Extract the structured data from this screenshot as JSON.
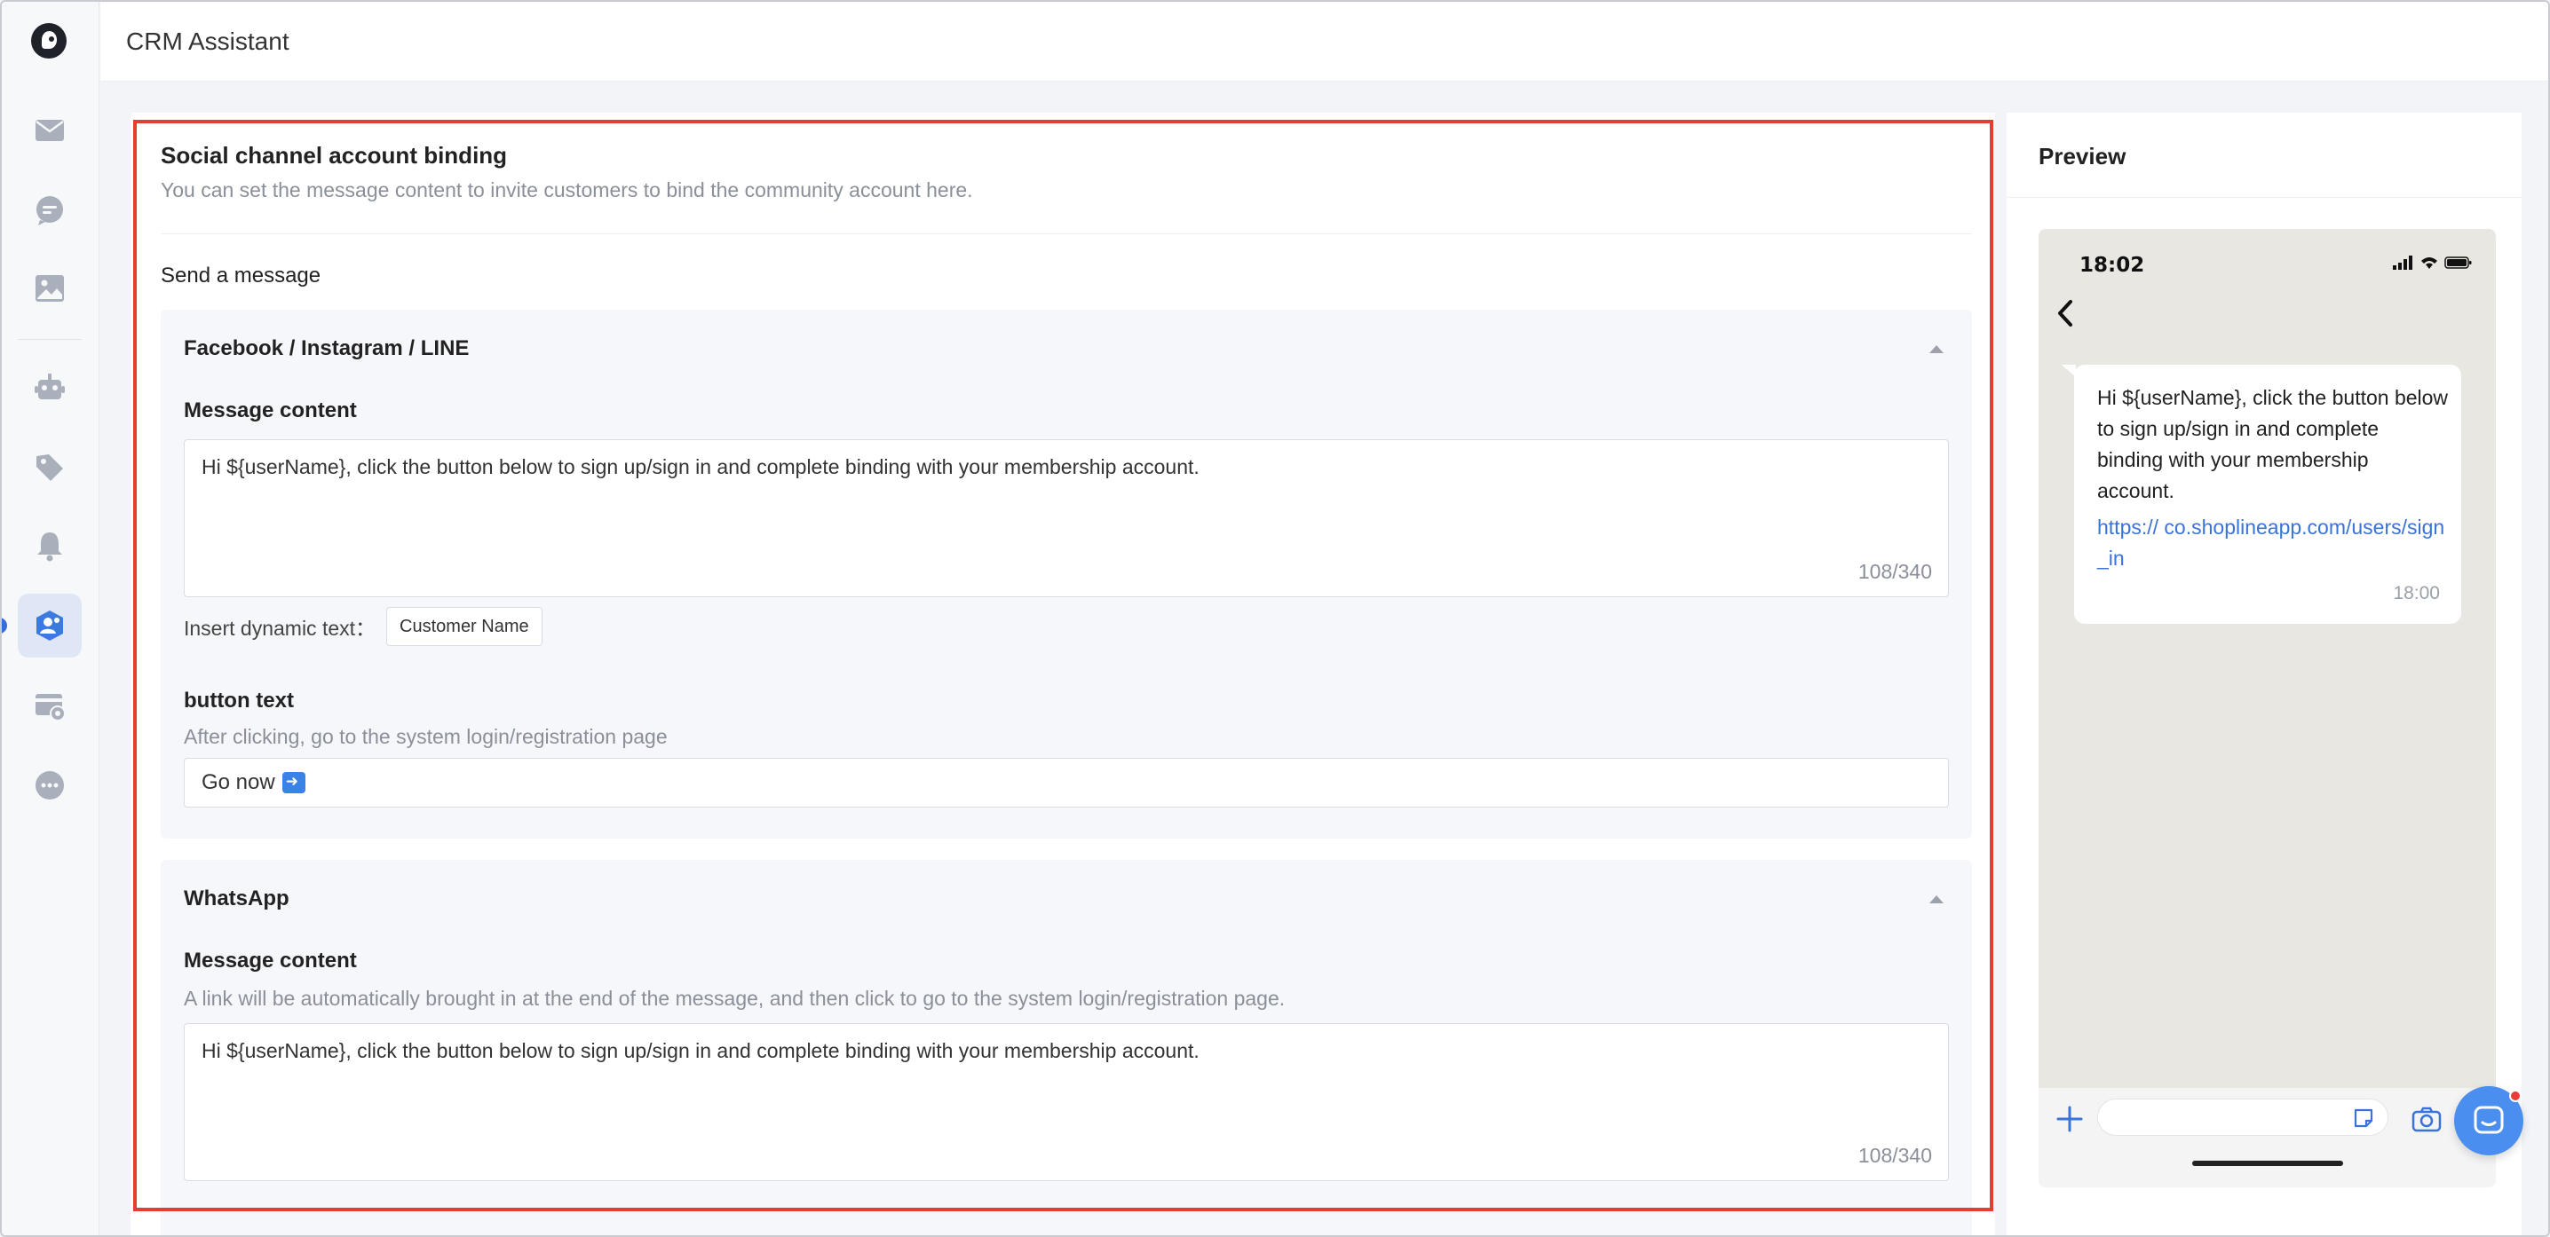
{
  "app": {
    "title": "CRM Assistant"
  },
  "sidebar": {
    "items": [
      {
        "name": "mail-icon",
        "active": false
      },
      {
        "name": "chat-icon",
        "active": false
      },
      {
        "name": "image-icon",
        "active": false
      },
      {
        "name": "robot-icon",
        "active": false
      },
      {
        "name": "tag-icon",
        "active": false
      },
      {
        "name": "bell-icon",
        "active": false
      },
      {
        "name": "member-icon",
        "active": true
      },
      {
        "name": "card-settings-icon",
        "active": false
      },
      {
        "name": "more-icon",
        "active": false
      }
    ]
  },
  "binding": {
    "title": "Social channel account binding",
    "description": "You can set the message content to invite customers to bind the community account here.",
    "send_label": "Send a message",
    "fb_card": {
      "title": "Facebook / Instagram / LINE",
      "message_label": "Message content",
      "message_value": "Hi ${userName}, click the button below to sign up/sign in and complete binding with your membership account.",
      "message_count": "108/340",
      "dynamic_label": "Insert dynamic text：",
      "dynamic_tag": "Customer Name",
      "button_label": "button text",
      "button_hint": "After clicking, go to the system login/registration page",
      "button_value": "Go now"
    },
    "wa_card": {
      "title": "WhatsApp",
      "message_label": "Message content",
      "message_hint": "A link will be automatically brought in at the end of the message, and then click to go to the system login/registration page.",
      "message_value": "Hi ${userName}, click the button below to sign up/sign in and complete binding with your membership account.",
      "message_count": "108/340"
    }
  },
  "preview": {
    "title": "Preview",
    "phone_time": "18:02",
    "bubble_text": "Hi ${userName}, click the button below to sign up/sign in and complete binding with your membership account.",
    "bubble_link": "https://            co.shoplineapp.com/users/sign_in",
    "bubble_time": "18:00"
  },
  "colors": {
    "accent": "#2f6fd6",
    "highlight": "#e0402c",
    "link": "#3a73d8",
    "fab": "#4a8ef0"
  }
}
